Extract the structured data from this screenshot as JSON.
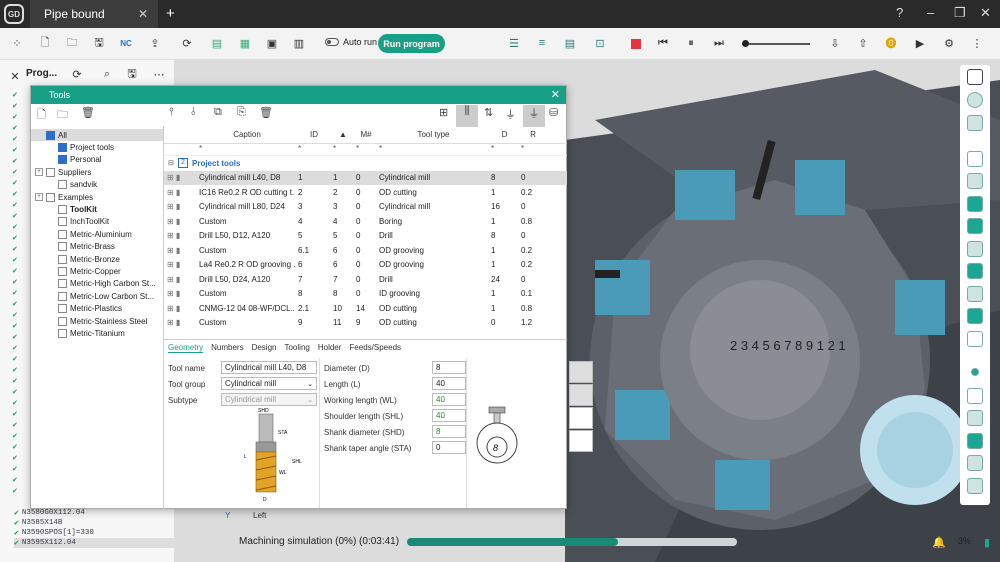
{
  "app": {
    "logo": "GD",
    "tab_title": "Pipe bound",
    "new_tab": "+",
    "help": "?",
    "minimize": "–",
    "restore": "❐",
    "close": "✕"
  },
  "toolbar": {
    "auto_run": "Auto run",
    "run_program": "Run program"
  },
  "left_panel": {
    "title": "Prog...",
    "code_lines": [
      {
        "text": "N3580G0X112.04",
        "status": "check"
      },
      {
        "text": "N3585X14B",
        "status": "check"
      },
      {
        "text": "N3590SPOS[1]=330",
        "status": "check"
      },
      {
        "text": "N3595X112.04",
        "status": "check",
        "highlight": true
      }
    ]
  },
  "dialog": {
    "title": "Tools",
    "tree": [
      {
        "label": "All",
        "level": 0,
        "checked": true,
        "expander": "",
        "selected": true
      },
      {
        "label": "Project tools",
        "level": 1,
        "checked": true,
        "expander": ""
      },
      {
        "label": "Personal",
        "level": 1,
        "checked": true,
        "expander": ""
      },
      {
        "label": "Suppliers",
        "level": 0,
        "checked": false,
        "expander": "+"
      },
      {
        "label": "sandvik",
        "level": 1,
        "checked": false,
        "expander": ""
      },
      {
        "label": "Examples",
        "level": 0,
        "checked": false,
        "expander": "+"
      },
      {
        "label": "ToolKit",
        "level": 1,
        "checked": false,
        "expander": "",
        "bold": true
      },
      {
        "label": "InchToolKit",
        "level": 1,
        "checked": false,
        "expander": ""
      },
      {
        "label": "Metric-Aluminium",
        "level": 1,
        "checked": false,
        "expander": ""
      },
      {
        "label": "Metric-Brass",
        "level": 1,
        "checked": false,
        "expander": ""
      },
      {
        "label": "Metric-Bronze",
        "level": 1,
        "checked": false,
        "expander": ""
      },
      {
        "label": "Metric-Copper",
        "level": 1,
        "checked": false,
        "expander": ""
      },
      {
        "label": "Metric-High Carbon St...",
        "level": 1,
        "checked": false,
        "expander": ""
      },
      {
        "label": "Metric-Low Carbon St...",
        "level": 1,
        "checked": false,
        "expander": ""
      },
      {
        "label": "Metric-Plastics",
        "level": 1,
        "checked": false,
        "expander": ""
      },
      {
        "label": "Metric-Stainless Steel",
        "level": 1,
        "checked": false,
        "expander": ""
      },
      {
        "label": "Metric-Titanium",
        "level": 1,
        "checked": false,
        "expander": ""
      }
    ],
    "columns": [
      "Caption",
      "ID",
      "▲",
      "M#",
      "Tool type",
      "D",
      "R"
    ],
    "filter": "*",
    "group": {
      "badge": "2",
      "label": "Project tools"
    },
    "rows": [
      {
        "caption": "Cylindrical mill L40, D8",
        "id": "1",
        "num": "1",
        "m": "0",
        "type": "Cylindrical mill",
        "d": "8",
        "r": "0",
        "selected": true
      },
      {
        "caption": "IC16 Re0.2 R OD cutting t...",
        "id": "2",
        "num": "2",
        "m": "0",
        "type": "OD cutting",
        "d": "1",
        "r": "0.2"
      },
      {
        "caption": "Cylindrical mill L80, D24",
        "id": "3",
        "num": "3",
        "m": "0",
        "type": "Cylindrical mill",
        "d": "16",
        "r": "0"
      },
      {
        "caption": "Custom",
        "id": "4",
        "num": "4",
        "m": "0",
        "type": "Boring",
        "d": "1",
        "r": "0.8"
      },
      {
        "caption": "Drill L50, D12, A120",
        "id": "5",
        "num": "5",
        "m": "0",
        "type": "Drill",
        "d": "8",
        "r": "0"
      },
      {
        "caption": "Custom",
        "id": "6.1",
        "num": "6",
        "m": "0",
        "type": "OD grooving",
        "d": "1",
        "r": "0.2"
      },
      {
        "caption": "La4 Re0.2 R OD grooving ...",
        "id": "6",
        "num": "6",
        "m": "0",
        "type": "OD grooving",
        "d": "1",
        "r": "0.2"
      },
      {
        "caption": "Drill L50, D24, A120",
        "id": "7",
        "num": "7",
        "m": "0",
        "type": "Drill",
        "d": "24",
        "r": "0"
      },
      {
        "caption": "Custom",
        "id": "8",
        "num": "8",
        "m": "0",
        "type": "ID grooving",
        "d": "1",
        "r": "0.1"
      },
      {
        "caption": "CNMG-12 04 08-WF/DCL...",
        "id": "2.1",
        "num": "10",
        "m": "14",
        "type": "OD cutting",
        "d": "1",
        "r": "0.8"
      },
      {
        "caption": "Custom",
        "id": "9",
        "num": "11",
        "m": "9",
        "type": "OD cutting",
        "d": "0",
        "r": "1.2"
      }
    ],
    "tabs": [
      "Geometry",
      "Numbers",
      "Design",
      "Tooling",
      "Holder",
      "Feeds/Speeds"
    ],
    "form": {
      "tool_name_label": "Tool name",
      "tool_name": "Cylindrical mill L40, D8",
      "tool_group_label": "Tool group",
      "tool_group": "Cylindrical mill",
      "subtype_label": "Subtype",
      "subtype": "Cylindrical mill",
      "diameter_label": "Diameter (D)",
      "diameter": "8",
      "length_label": "Length (L)",
      "length": "40",
      "wl_label": "Working length (WL)",
      "wl": "40",
      "shl_label": "Shoulder length (SHL)",
      "shl": "40",
      "shd_label": "Shank diameter (SHD)",
      "shd": "8",
      "sta_label": "Shank taper angle (STA)",
      "sta": "0"
    },
    "diagram_labels": {
      "shd": "SHD",
      "sta": "STA",
      "l": "L",
      "wl": "WL",
      "shl": "SHL",
      "d": "D",
      "holder_num": "8"
    }
  },
  "status": {
    "text": "Machining simulation (0%) (0:03:41)",
    "progress": 0.64,
    "percent": "3%"
  },
  "viewport": {
    "turret_numbers": "2 3 4 5 6 7 8 9 1 2 1",
    "axis_label": "Left",
    "axis_y": "Y"
  }
}
